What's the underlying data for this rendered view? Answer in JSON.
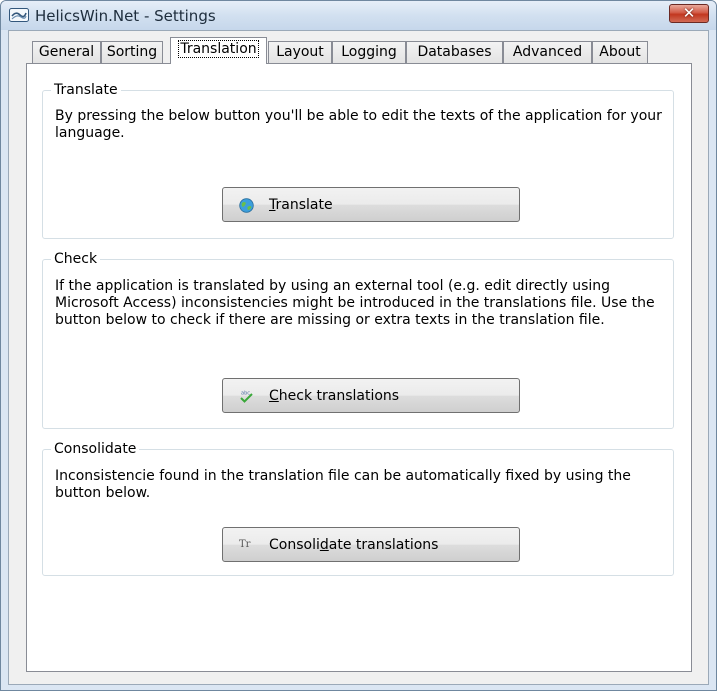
{
  "window": {
    "title": "HelicsWin.Net - Settings",
    "close_glyph": "✕"
  },
  "tabs": [
    "General",
    "Sorting",
    "Translation",
    "Layout",
    "Logging",
    "Databases",
    "Advanced",
    "About"
  ],
  "active_tab": "Translation",
  "translate": {
    "legend": "Translate",
    "desc": "By pressing the below button you'll be able to edit the texts of the application for your language.",
    "button_mnemonic": "T",
    "button_rest": "ranslate",
    "icon": "globe-icon"
  },
  "check": {
    "legend": "Check",
    "desc": "If the application is translated by using an external tool (e.g. edit directly using Microsoft Access) inconsistencies might be introduced in the translations file. Use the button below to check if there are missing or extra texts in the translation file.",
    "button_mnemonic": "C",
    "button_rest": "heck translations",
    "icon": "spellcheck-icon"
  },
  "consolidate": {
    "legend": "Consolidate",
    "desc": "Inconsistencie found in the translation file can be automatically fixed by using the button below.",
    "button_pre": "Consoli",
    "button_mnemonic": "d",
    "button_post": "ate translations",
    "icon": "text-format-icon",
    "icon_text": "Tr"
  }
}
